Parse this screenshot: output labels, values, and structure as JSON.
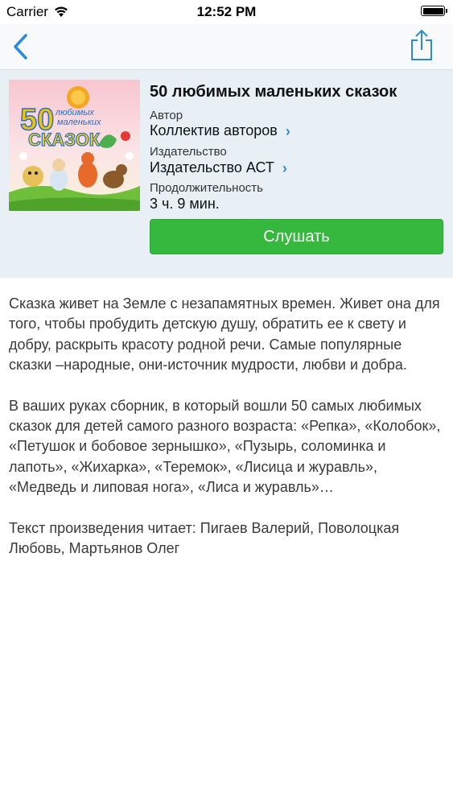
{
  "status_bar": {
    "carrier": "Carrier",
    "time": "12:52 PM"
  },
  "nav": {
    "back_icon": "chevron-left-icon",
    "share_icon": "share-icon",
    "accent_color": "#2a8adb"
  },
  "book": {
    "title": "50 любимых маленьких сказок",
    "cover_text_number": "50",
    "cover_text_line1": "любимых",
    "cover_text_line2": "маленьких",
    "cover_text_line3": "СКАЗОК",
    "author_label": "Автор",
    "author_value": "Коллектив авторов",
    "publisher_label": "Издательство",
    "publisher_value": "Издательство АСТ",
    "duration_label": "Продолжительность",
    "duration_value": "3 ч. 9 мин.",
    "listen_label": "Слушать",
    "listen_color": "#36b83f"
  },
  "description": {
    "paragraphs": [
      "Сказка живет на Земле с незапамятных времен. Живет она для того, чтобы пробудить детскую душу, обратить ее к свету и добру, раскрыть красоту родной речи. Самые популярные сказки –народные, они-источник мудрости, любви и добра.",
      "В ваших руках сборник, в который вошли 50 самых любимых сказок для детей самого разного возраста: «Репка», «Колобок», «Петушок и бобовое зернышко», «Пузырь, соломинка и лапоть», «Жихарка», «Теремок», «Лисица и журавль», «Медведь и липовая нога», «Лиса и журавль»…",
      "Текст произведения читает: Пигаев Валерий, Поволоцкая Любовь, Мартьянов Олег"
    ]
  }
}
